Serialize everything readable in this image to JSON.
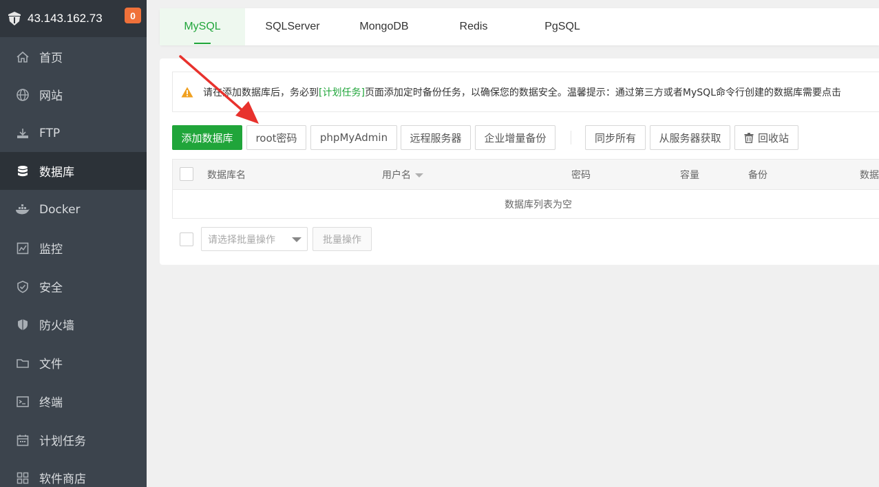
{
  "sidebar": {
    "server_ip": "43.143.162.73",
    "notification_count": "0",
    "items": [
      {
        "label": "首页",
        "icon": "home-icon"
      },
      {
        "label": "网站",
        "icon": "globe-icon"
      },
      {
        "label": "FTP",
        "icon": "ftp-icon"
      },
      {
        "label": "数据库",
        "icon": "database-icon",
        "active": true
      },
      {
        "label": "Docker",
        "icon": "docker-icon"
      },
      {
        "label": "监控",
        "icon": "monitor-icon"
      },
      {
        "label": "安全",
        "icon": "shield-icon"
      },
      {
        "label": "防火墙",
        "icon": "firewall-icon"
      },
      {
        "label": "文件",
        "icon": "folder-icon"
      },
      {
        "label": "终端",
        "icon": "terminal-icon"
      },
      {
        "label": "计划任务",
        "icon": "calendar-icon"
      },
      {
        "label": "软件商店",
        "icon": "apps-icon"
      }
    ]
  },
  "tabs": [
    {
      "label": "MySQL",
      "active": true
    },
    {
      "label": "SQLServer"
    },
    {
      "label": "MongoDB"
    },
    {
      "label": "Redis"
    },
    {
      "label": "PgSQL"
    }
  ],
  "alert": {
    "text_before": "请在添加数据库后，务必到",
    "link": "[计划任务]",
    "text_after": "页面添加定时备份任务，以确保您的数据安全。温馨提示：通过第三方或者MySQL命令行创建的数据库需要点击"
  },
  "toolbar": {
    "add_db": "添加数据库",
    "root_password": "root密码",
    "phpmyadmin": "phpMyAdmin",
    "remote_server": "远程服务器",
    "enterprise_backup": "企业增量备份",
    "sync_all": "同步所有",
    "fetch_from_server": "从服务器获取",
    "recycle_bin": "回收站"
  },
  "table": {
    "columns": [
      "数据库名",
      "用户名",
      "密码",
      "容量",
      "备份",
      "数据"
    ],
    "empty_text": "数据库列表为空"
  },
  "batch": {
    "select_placeholder": "请选择批量操作",
    "button": "批量操作"
  },
  "colors": {
    "accent": "#20a53a",
    "sidebar_bg": "#3c444d",
    "badge": "#f0713a",
    "annotation_arrow": "#e8322d"
  }
}
